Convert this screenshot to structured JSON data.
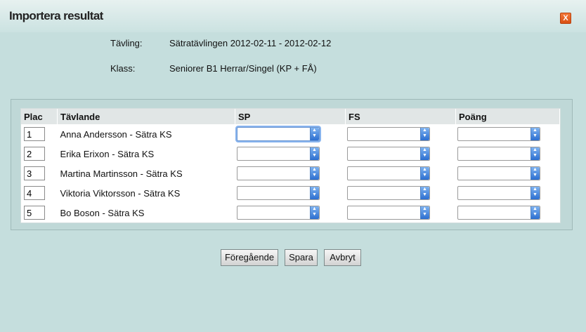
{
  "dialog": {
    "title": "Importera resultat",
    "close_label": "X"
  },
  "info": {
    "competition_label": "Tävling:",
    "competition_value": "Sätratävlingen 2012-02-11 - 2012-02-12",
    "class_label": "Klass:",
    "class_value": "Seniorer B1 Herrar/Singel (KP + FÅ)"
  },
  "table": {
    "headers": [
      "Plac",
      "Tävlande",
      "SP",
      "FS",
      "Poäng"
    ],
    "rows": [
      {
        "plac": "1",
        "name": "Anna Andersson - Sätra KS",
        "sp": "",
        "fs": "",
        "points": ""
      },
      {
        "plac": "2",
        "name": "Erika Erixon - Sätra KS",
        "sp": "",
        "fs": "",
        "points": ""
      },
      {
        "plac": "3",
        "name": "Martina Martinsson - Sätra KS",
        "sp": "",
        "fs": "",
        "points": ""
      },
      {
        "plac": "4",
        "name": "Viktoria Viktorsson - Sätra KS",
        "sp": "",
        "fs": "",
        "points": ""
      },
      {
        "plac": "5",
        "name": "Bo Boson - Sätra KS",
        "sp": "",
        "fs": "",
        "points": ""
      }
    ]
  },
  "buttons": {
    "previous": "Föregående",
    "save": "Spara",
    "cancel": "Avbryt"
  }
}
